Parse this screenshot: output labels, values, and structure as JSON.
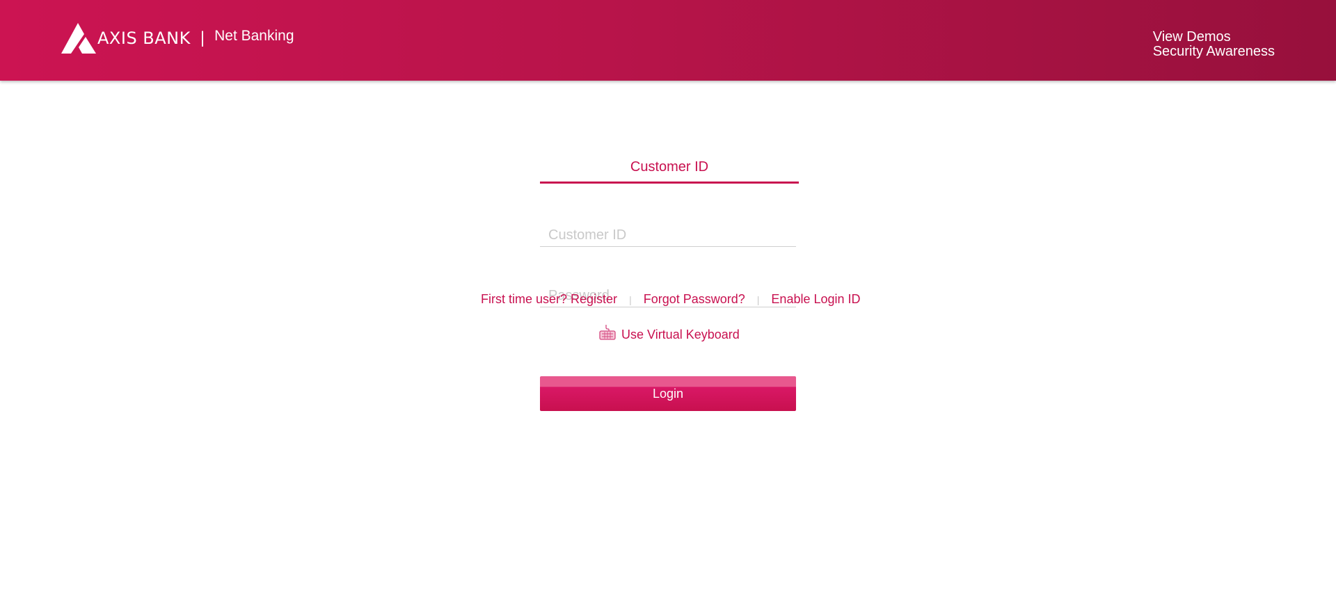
{
  "header": {
    "logo_text": "AXIS BANK",
    "separator": "|",
    "product_name": "Net Banking",
    "links": [
      {
        "label": "View Demos"
      },
      {
        "label": "Security Awareness"
      }
    ]
  },
  "login": {
    "active_tab": "Customer ID",
    "customer_id_placeholder": "Customer ID",
    "customer_id_value": "",
    "password_placeholder": "Password",
    "password_value": "",
    "virtual_keyboard_label": "Use Virtual Keyboard",
    "login_button_label": "Login"
  },
  "footer_links": {
    "register": "First time user? Register",
    "forgot_password": "Forgot Password?",
    "enable_login_id": "Enable Login ID",
    "separator": "|"
  },
  "colors": {
    "brand": "#c8104f",
    "header_start": "#cc1452",
    "header_end": "#97103c"
  },
  "icons": {
    "logo": "axis-bank-logo-icon",
    "virtual_keyboard": "keyboard-icon"
  }
}
